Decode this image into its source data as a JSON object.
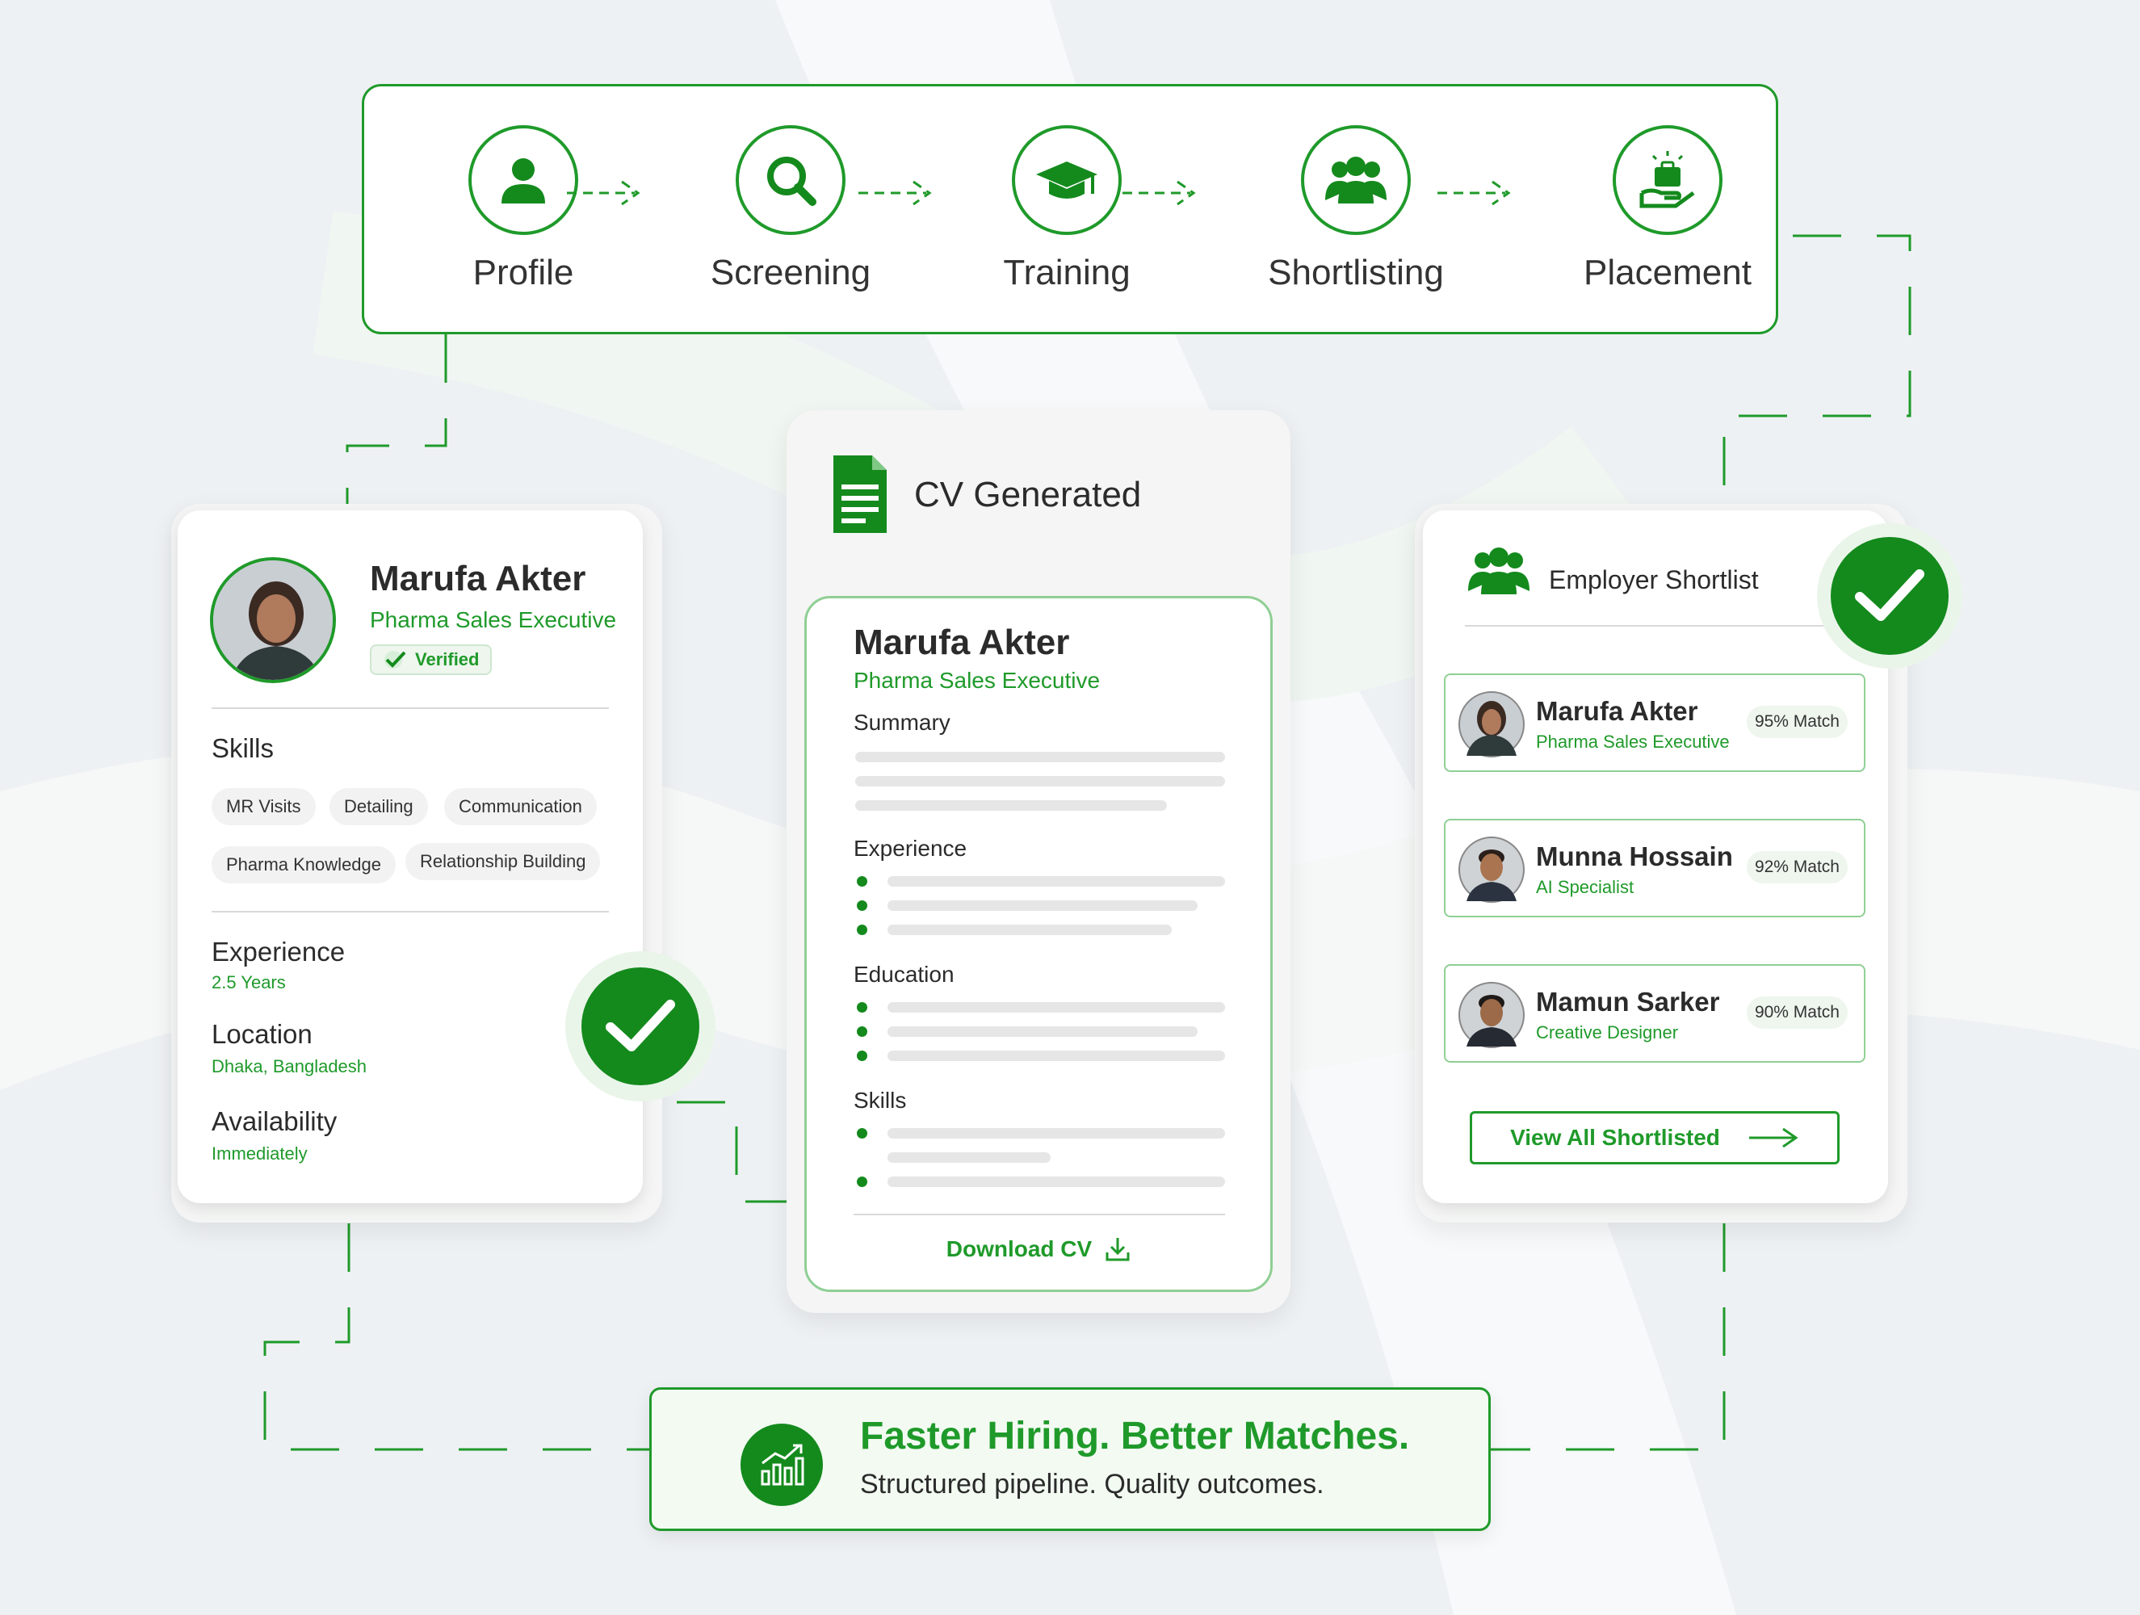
{
  "pipeline": {
    "steps": [
      {
        "label": "Profile",
        "icon": "user-icon"
      },
      {
        "label": "Screening",
        "icon": "search-icon"
      },
      {
        "label": "Training",
        "icon": "graduation-cap-icon"
      },
      {
        "label": "Shortlisting",
        "icon": "group-icon"
      },
      {
        "label": "Placement",
        "icon": "briefcase-hand-icon"
      }
    ]
  },
  "profile": {
    "name": "Marufa Akter",
    "role": "Pharma Sales Executive",
    "verified": "Verified",
    "skills_title": "Skills",
    "skills": [
      "MR Visits",
      "Detailing",
      "Communication",
      "Pharma Knowledge",
      "Relationship Building"
    ],
    "experience_title": "Experience",
    "experience_value": "2.5 Years",
    "location_title": "Location",
    "location_value": "Dhaka, Bangladesh",
    "availability_title": "Availability",
    "availability_value": "Immediately"
  },
  "cv": {
    "title": "CV Generated",
    "name": "Marufa Akter",
    "role": "Pharma Sales Executive",
    "sections": [
      "Summary",
      "Experience",
      "Education",
      "Skills"
    ],
    "download_label": "Download CV"
  },
  "shortlist": {
    "title": "Employer Shortlist",
    "candidates": [
      {
        "name": "Marufa Akter",
        "role": "Pharma Sales Executive",
        "match": "95% Match"
      },
      {
        "name": "Munna Hossain",
        "role": "AI Specialist",
        "match": "92% Match"
      },
      {
        "name": "Mamun Sarker",
        "role": "Creative Designer",
        "match": "90% Match"
      }
    ],
    "view_all": "View All Shortlisted"
  },
  "banner": {
    "headline": "Faster Hiring. Better Matches.",
    "subline": "Structured pipeline. Quality outcomes."
  },
  "colors": {
    "accent": "#1f9a2a",
    "accent_dark": "#148a1d",
    "background": "#eef1f4"
  }
}
